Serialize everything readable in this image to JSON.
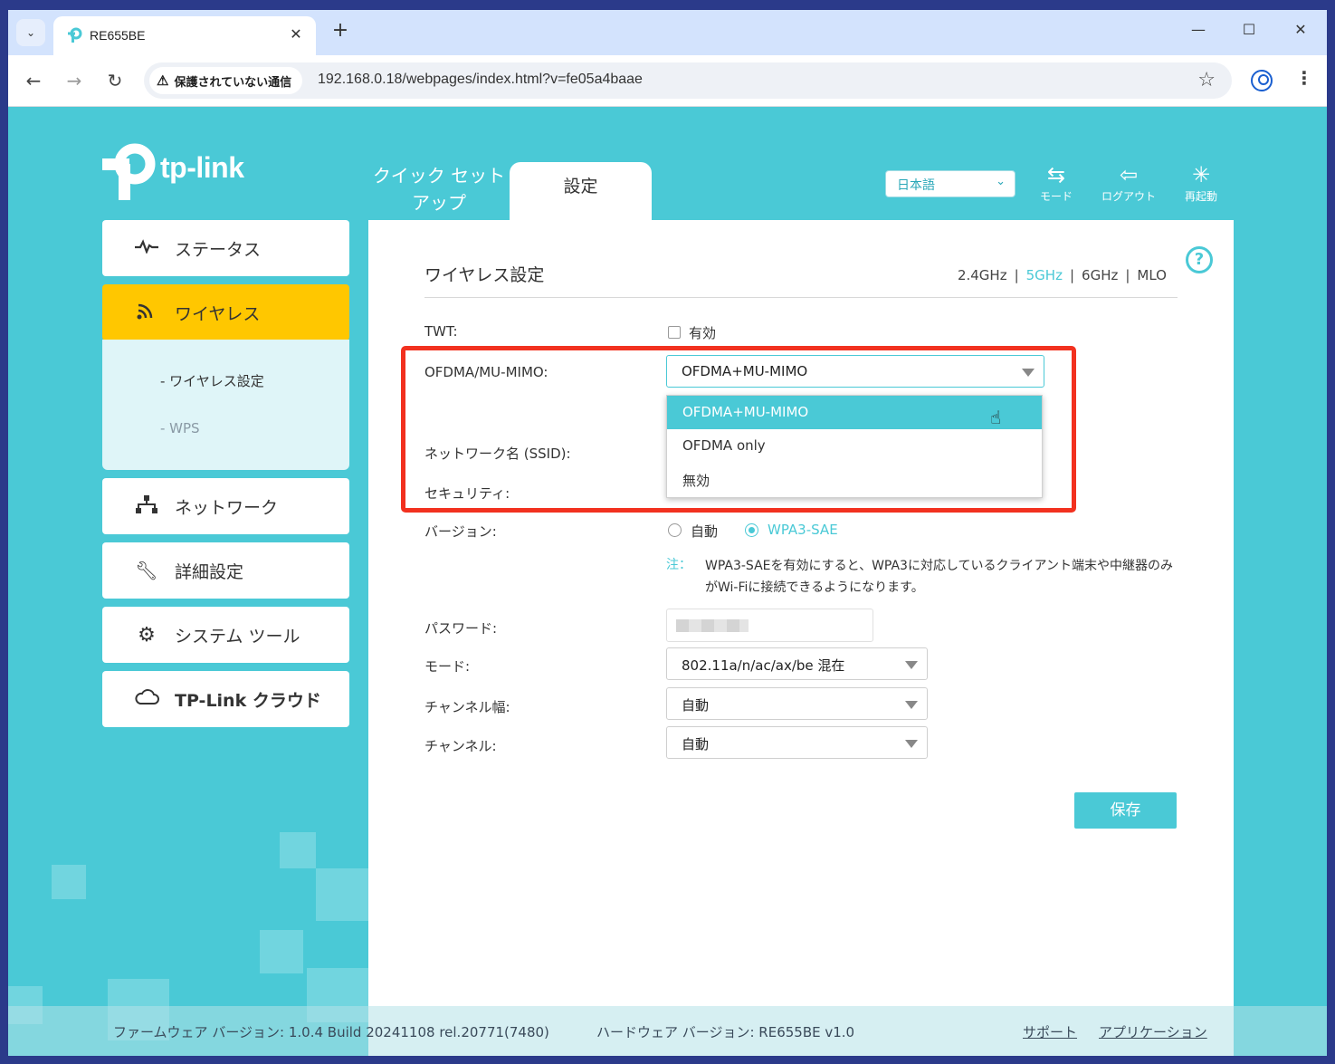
{
  "browser": {
    "tab_title": "RE655BE",
    "security_label": "保護されていない通信",
    "url": "192.168.0.18/webpages/index.html?v=fe05a4baae"
  },
  "header": {
    "brand": "tp-link",
    "tabs": {
      "quick_setup": "クイック セット\nアップ",
      "settings": "設定"
    },
    "language": "日本語",
    "actions": {
      "mode": "モード",
      "logout": "ログアウト",
      "reboot": "再起動"
    }
  },
  "sidebar": {
    "items": [
      {
        "label": "ステータス",
        "icon": "pulse-icon"
      },
      {
        "label": "ワイヤレス",
        "icon": "wifi-icon",
        "active": true
      },
      {
        "label": "ネットワーク",
        "icon": "network-icon"
      },
      {
        "label": "詳細設定",
        "icon": "wrench-icon"
      },
      {
        "label": "システム ツール",
        "icon": "gear-icon"
      },
      {
        "label": "TP-Link クラウド",
        "icon": "cloud-icon"
      }
    ],
    "sub_items": [
      "- ワイヤレス設定",
      "- WPS"
    ]
  },
  "main": {
    "title": "ワイヤレス設定",
    "bands": [
      "2.4GHz",
      "5GHz",
      "6GHz",
      "MLO"
    ],
    "selected_band": "5GHz",
    "twt": {
      "label": "TWT:",
      "checkbox_label": "有効",
      "checked": false
    },
    "ofdma": {
      "label": "OFDMA/MU-MIMO:",
      "value": "OFDMA+MU-MIMO",
      "options": [
        "OFDMA+MU-MIMO",
        "OFDMA only",
        "無効"
      ],
      "highlighted": "OFDMA+MU-MIMO"
    },
    "ssid_label": "ネットワーク名 (SSID):",
    "security_label": "セキュリティ:",
    "version": {
      "label": "バージョン:",
      "options": [
        "自動",
        "WPA3-SAE"
      ],
      "selected": "WPA3-SAE"
    },
    "note": {
      "key": "注：",
      "text": "WPA3-SAEを有効にすると、WPA3に対応しているクライアント端末や中継器のみがWi-Fiに接続できるようになります。"
    },
    "password_label": "パスワード:",
    "mode": {
      "label": "モード:",
      "value": "802.11a/n/ac/ax/be 混在"
    },
    "channel_width": {
      "label": "チャンネル幅:",
      "value": "自動"
    },
    "channel": {
      "label": "チャンネル:",
      "value": "自動"
    },
    "save_label": "保存"
  },
  "footer": {
    "firmware": "ファームウェア バージョン: 1.0.4 Build 20241108 rel.20771(7480)",
    "hardware": "ハードウェア バージョン: RE655BE v1.0",
    "links": [
      "サポート",
      "アプリケーション"
    ]
  },
  "colors": {
    "accent": "#4ac9d6",
    "active_menu": "#ffc700",
    "highlight_box": "#f2311f"
  }
}
